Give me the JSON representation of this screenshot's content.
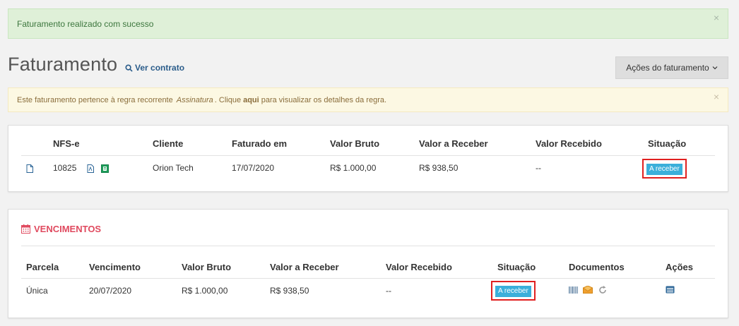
{
  "alerts": {
    "success_text": "Faturamento realizado com sucesso",
    "warning_prefix": "Este faturamento pertence à regra recorrente",
    "warning_rule": "Assinatura",
    "warning_mid": ". Clique",
    "warning_link": "aqui",
    "warning_suffix": "para visualizar os detalhes da regra.",
    "close_glyph": "×"
  },
  "header": {
    "title": "Faturamento",
    "view_contract_label": "Ver contrato",
    "actions_label": "Ações do faturamento",
    "actions_caret": "⌄"
  },
  "invoice_table": {
    "columns": [
      "NFS-e",
      "Cliente",
      "Faturado em",
      "Valor Bruto",
      "Valor a Receber",
      "Valor Recebido",
      "Situação"
    ],
    "row": {
      "nfse": "10825",
      "cliente": "Orion Tech",
      "faturado_em": "17/07/2020",
      "valor_bruto": "R$ 1.000,00",
      "valor_a_receber": "R$ 938,50",
      "valor_recebido": "--",
      "situacao": "A receber"
    }
  },
  "vencimentos": {
    "title": "VENCIMENTOS",
    "columns": [
      "Parcela",
      "Vencimento",
      "Valor Bruto",
      "Valor a Receber",
      "Valor Recebido",
      "Situação",
      "Documentos",
      "Ações"
    ],
    "row": {
      "parcela": "Única",
      "vencimento": "20/07/2020",
      "valor_bruto": "R$ 1.000,00",
      "valor_a_receber": "R$ 938,50",
      "valor_recebido": "--",
      "situacao": "A receber"
    }
  },
  "colors": {
    "success_bg": "#dff0d8",
    "warning_bg": "#fcf8e3",
    "badge": "#3bafda",
    "highlight": "#e02020",
    "section_title": "#e04a5f"
  }
}
